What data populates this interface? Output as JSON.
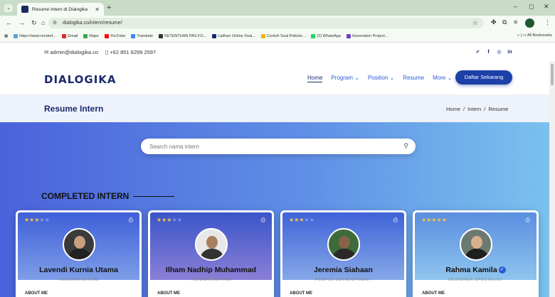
{
  "browser": {
    "tab_title": "Resume Intern di Dialogika",
    "url": "dialogika.co/intern/resume/",
    "bookmarks": [
      "https://www.renderf...",
      "Gmail",
      "Maps",
      "YouTube",
      "Translate",
      "KETENTUAN PAS FO...",
      "Latihan Online Soal...",
      "Contoh Soal Psikote...",
      "(2) WhatsApp",
      "Generation Project..."
    ],
    "all_bookmarks_label": "All Bookmarks",
    "colors": {
      "chrome_bg": "#c8dcc7",
      "tab_bg": "#f5faf4"
    }
  },
  "topbar": {
    "email": "admin@dialogika.co",
    "phone": "+62 851 6299 2597",
    "social_icons": [
      "twitter-icon",
      "facebook-icon",
      "instagram-icon",
      "linkedin-icon"
    ]
  },
  "nav": {
    "logo": "DIALOGIKA",
    "items": [
      {
        "label": "Home",
        "active": true
      },
      {
        "label": "Program ⌄",
        "active": false
      },
      {
        "label": "Position ⌄",
        "active": false
      },
      {
        "label": "Resume",
        "active": false
      },
      {
        "label": "More ⌄",
        "active": false
      }
    ],
    "cta": "Daftar Sekarang",
    "colors": {
      "brand": "#1a2a6c",
      "cta": "#1c3fa8"
    }
  },
  "pagehead": {
    "title": "Resume Intern",
    "breadcrumb": [
      "Home",
      "Intern",
      "Resume"
    ]
  },
  "hero": {
    "search_placeholder": "Search nama intern",
    "section_title": "COMPLETED INTERN"
  },
  "cards": [
    {
      "name": "Lavendi Kurnia Utama",
      "role": "TELEMARKETING",
      "rating": 3,
      "about": "ABOUT ME",
      "verified": false
    },
    {
      "name": "Ilham Nadhip Muhammad",
      "role": "TELEMARKETING",
      "rating": 3,
      "about": "ABOUT ME",
      "verified": false
    },
    {
      "name": "Jeremia Siahaan",
      "role": "PEOPLE DEVELOPMENT",
      "rating": 3,
      "about": "ABOUT ME",
      "verified": false
    },
    {
      "name": "Rahma Kamila",
      "role": "DESIGNER SPECIALIST",
      "rating": 5,
      "about": "ABOUT ME",
      "verified": true
    }
  ]
}
